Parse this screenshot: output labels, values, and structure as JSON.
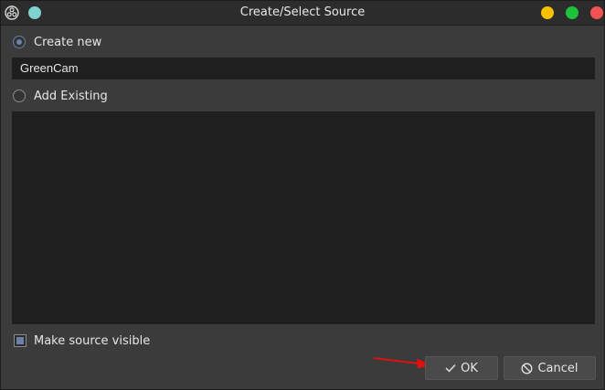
{
  "window": {
    "title": "Create/Select Source"
  },
  "options": {
    "create_new": {
      "label": "Create new",
      "selected": true
    },
    "add_existing": {
      "label": "Add Existing",
      "selected": false
    }
  },
  "name_input": {
    "value": "GreenCam"
  },
  "existing_sources": [],
  "make_visible": {
    "label": "Make source visible",
    "checked": true
  },
  "buttons": {
    "ok_label": "OK",
    "cancel_label": "Cancel"
  },
  "colors": {
    "accent": "#6b7fa8",
    "minimize": "#f7c000",
    "maximize": "#1ec13a",
    "close": "#f15353",
    "pin": "#7fd3cf",
    "annotation_arrow": "#e01010"
  },
  "icons": {
    "app": "obs-logo-icon",
    "ok": "checkmark-icon",
    "cancel": "prohibited-icon"
  }
}
